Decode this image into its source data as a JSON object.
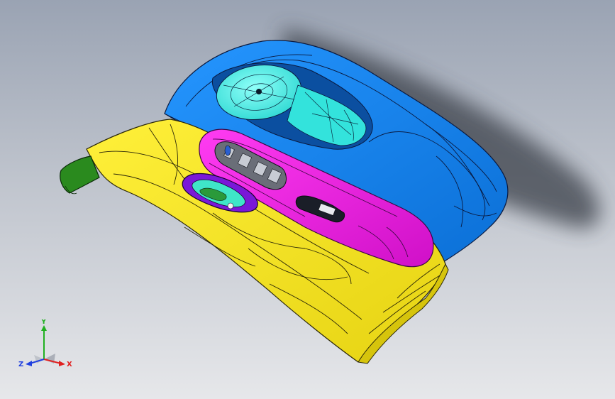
{
  "viewport": {
    "background_top": "#9aa3b3",
    "background_bottom": "#e6e7ea"
  },
  "model": {
    "parts": [
      {
        "name": "upper-panel",
        "color": "#1a86f0"
      },
      {
        "name": "lower-panel",
        "color": "#f4e61c"
      },
      {
        "name": "armrest",
        "color": "#f01ee6"
      },
      {
        "name": "speaker-pocket",
        "color": "#3ff0e8"
      },
      {
        "name": "door-handle-bezel",
        "color": "#8a1ee6"
      },
      {
        "name": "end-clip",
        "color": "#2a8a1e"
      }
    ]
  },
  "triad": {
    "x_label": "X",
    "y_label": "Y",
    "z_label": "Z",
    "x_color": "#e02020",
    "y_color": "#20b020",
    "z_color": "#2040e0"
  }
}
